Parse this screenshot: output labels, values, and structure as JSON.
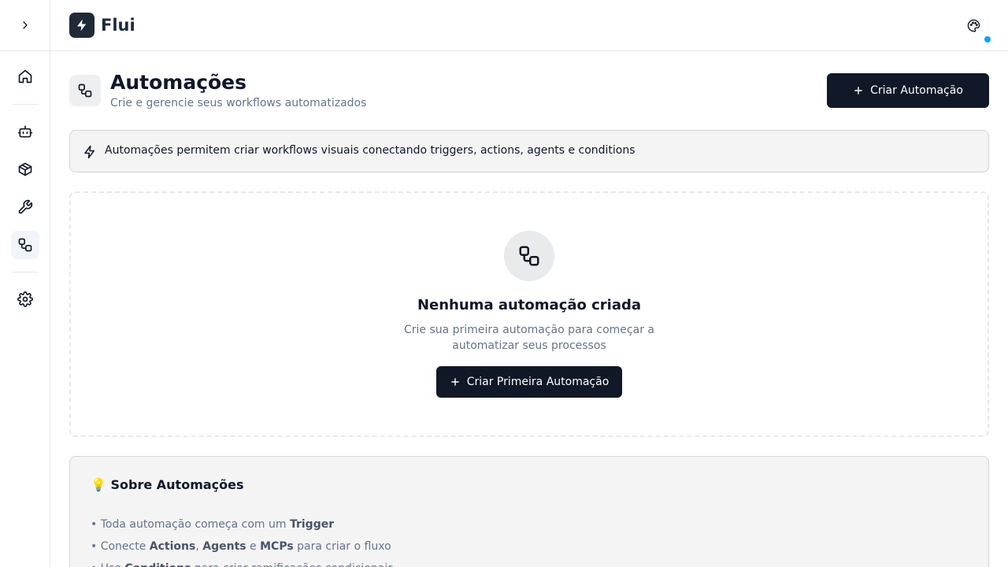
{
  "app": {
    "name": "Flui"
  },
  "sidebar": {
    "items": [
      {
        "name": "home",
        "icon": "home-icon"
      },
      {
        "name": "agents",
        "icon": "bot-icon"
      },
      {
        "name": "packages",
        "icon": "package-icon"
      },
      {
        "name": "tools",
        "icon": "wrench-icon"
      },
      {
        "name": "automations",
        "icon": "workflow-icon",
        "active": true
      },
      {
        "name": "settings",
        "icon": "gear-icon"
      }
    ]
  },
  "header": {
    "notification_color": "#0ea5e9"
  },
  "page": {
    "title": "Automações",
    "subtitle": "Crie e gerencie seus workflows automatizados",
    "create_label": "Criar Automação"
  },
  "info": {
    "text": "Automações permitem criar workflows visuais conectando triggers, actions, agents e conditions"
  },
  "empty_state": {
    "title": "Nenhuma automação criada",
    "description": "Crie sua primeira automação para começar a automatizar seus processos",
    "button_label": "Criar Primeira Automação"
  },
  "about": {
    "emoji": "💡",
    "title": "Sobre Automações",
    "items": [
      {
        "segments": [
          {
            "t": "Toda automação começa com um "
          },
          {
            "t": "Trigger",
            "b": true
          }
        ]
      },
      {
        "segments": [
          {
            "t": "Conecte "
          },
          {
            "t": "Actions",
            "b": true
          },
          {
            "t": ", "
          },
          {
            "t": "Agents",
            "b": true
          },
          {
            "t": " e "
          },
          {
            "t": "MCPs",
            "b": true
          },
          {
            "t": " para criar o fluxo"
          }
        ]
      },
      {
        "segments": [
          {
            "t": "Use "
          },
          {
            "t": "Conditions",
            "b": true
          },
          {
            "t": " para criar ramificações condicionais"
          }
        ]
      }
    ]
  },
  "colors": {
    "primary": "#111827",
    "accent": "#0ea5e9"
  }
}
